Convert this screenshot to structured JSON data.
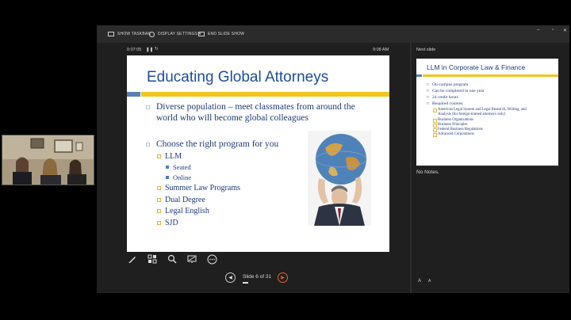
{
  "toolbar": {
    "show_taskbar": "SHOW TASKBAR",
    "display_settings": "DISPLAY SETTINGS ▾",
    "end_slide_show": "END SLIDE SHOW"
  },
  "window_buttons": [
    "–",
    "▫",
    "✕"
  ],
  "presenter": {
    "timer": "0:07:05",
    "pause_icon": "pause-icon",
    "restart_icon": "restart-icon",
    "clock": "9:08 AM"
  },
  "slide": {
    "title": "Educating Global Attorneys",
    "bullets": [
      {
        "text": "Diverse population – meet classmates from around the",
        "level": 1
      },
      {
        "text": "world who will become global colleagues",
        "level": 1,
        "continuation": true
      },
      {
        "text": "Choose the right program for you",
        "level": 1
      },
      {
        "text": "LLM",
        "level": 2
      },
      {
        "text": "Seated",
        "level": 3
      },
      {
        "text": "Online",
        "level": 3
      },
      {
        "text": "Summer Law Programs",
        "level": 2
      },
      {
        "text": "Dual Degree",
        "level": 2
      },
      {
        "text": "Legal English",
        "level": 2
      },
      {
        "text": "SJD",
        "level": 2
      }
    ]
  },
  "tools": [
    "pen-icon",
    "see-all-slides-icon",
    "zoom-icon",
    "black-screen-icon",
    "more-options-icon"
  ],
  "navigation": {
    "prev_icon": "prev-arrow-icon",
    "counter": "Slide 6 of 31",
    "next_icon": "next-arrow-icon"
  },
  "next_slide": {
    "label": "Next slide",
    "title": "LLM in Corporate Law & Finance",
    "bullets": [
      "On-campus program",
      "Can be completed in one year",
      "24 credit hours",
      "Required courses:"
    ],
    "sub_bullets": [
      "American Legal System and Legal Research, Writing, and",
      "Analysis (for foreign-trained attorneys only)",
      "Business Organizations",
      "Business Principles",
      "Federal Business Regulations",
      "Advanced Corporations"
    ]
  },
  "notes": {
    "text": "No Notes.",
    "font_larger": "A",
    "font_smaller": "A"
  },
  "colors": {
    "title_blue": "#1f4e9a",
    "accent_gold": "#f2c51f",
    "band_blue": "#5a7fb5",
    "next_button": "#e8622a"
  }
}
